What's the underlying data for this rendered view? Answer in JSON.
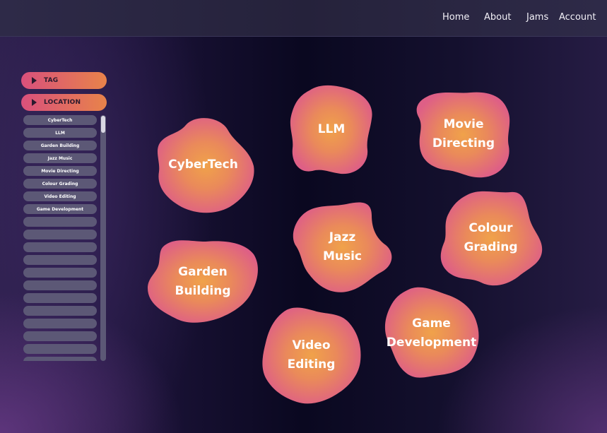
{
  "nav": {
    "home": "Home",
    "about": "About",
    "jams": "Jams",
    "account": "Account"
  },
  "filters": {
    "tag_label": "TAG",
    "location_label": "LOCATION",
    "items": [
      "CyberTech",
      "LLM",
      "Garden Building",
      "Jazz Music",
      "Movie Directing",
      "Colour Grading",
      "Video Editing",
      "Game Development",
      "",
      "",
      "",
      "",
      "",
      "",
      "",
      "",
      "",
      "",
      "",
      ""
    ]
  },
  "topics": {
    "cybertech": "CyberTech",
    "llm": "LLM",
    "movie_directing": "Movie\nDirecting",
    "jazz_music": "Jazz\nMusic",
    "colour_grading": "Colour\nGrading",
    "garden_building": "Garden\nBuilding",
    "game_development": "Game\nDevelopment",
    "video_editing": "Video\nEditing"
  },
  "colors": {
    "blob_center": "#f0a24a",
    "blob_edge": "#de5f86",
    "pill_start": "#d9507c",
    "pill_end": "#e8834a"
  }
}
